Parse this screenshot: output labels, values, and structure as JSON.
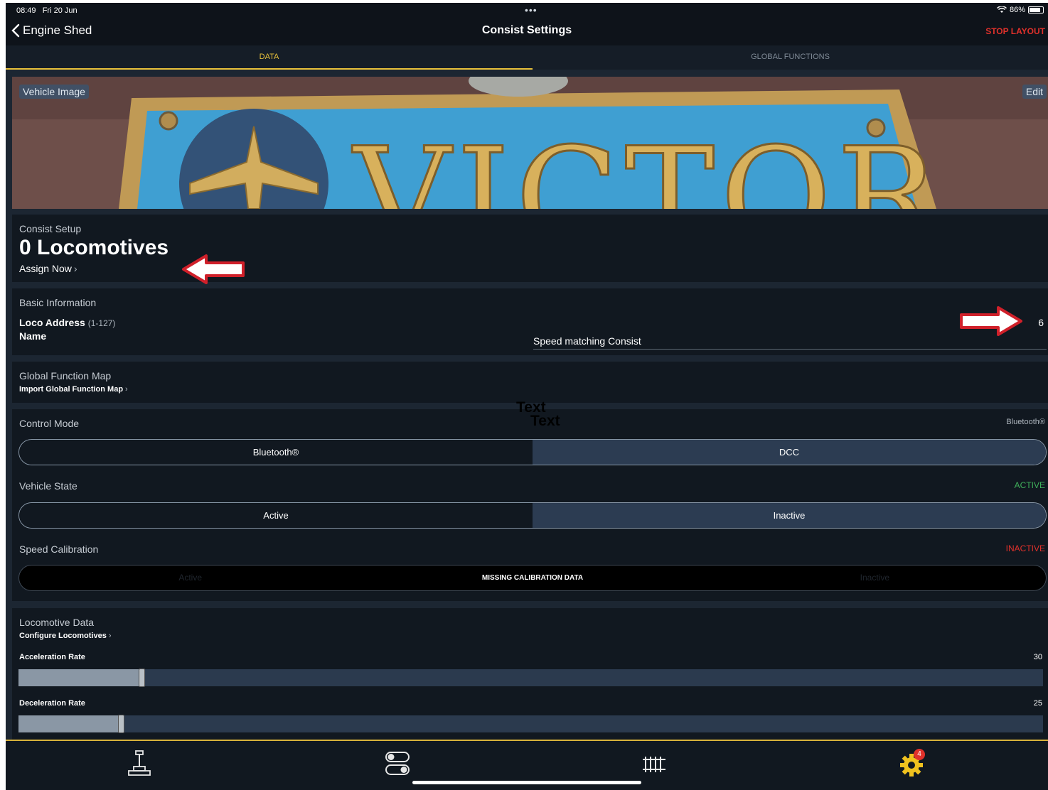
{
  "status": {
    "time": "08:49",
    "date": "Fri 20 Jun",
    "battery": "86%",
    "battery_fraction": 0.86,
    "dots": "•••"
  },
  "nav": {
    "back_label": "Engine Shed",
    "title": "Consist Settings",
    "stop_label": "STOP LAYOUT"
  },
  "tabs": {
    "data": "DATA",
    "global": "GLOBAL FUNCTIONS"
  },
  "hero": {
    "label": "Vehicle Image",
    "edit": "Edit",
    "plate_text": "VICTOR"
  },
  "consist": {
    "title": "Consist Setup",
    "count": "0 Locomotives",
    "assign": "Assign Now"
  },
  "basic": {
    "title": "Basic Information",
    "address_label": "Loco Address",
    "address_range": "(1-127)",
    "address_value": "6",
    "name_label": "Name",
    "name_value": "Speed matching Consist"
  },
  "global_map": {
    "title": "Global Function Map",
    "import": "Import Global Function Map"
  },
  "overlay": {
    "text1": "Text",
    "text2": "Text"
  },
  "control_mode": {
    "title": "Control Mode",
    "current": "Bluetooth®",
    "options": [
      "Bluetooth®",
      "DCC"
    ]
  },
  "vehicle_state": {
    "title": "Vehicle State",
    "current": "ACTIVE",
    "options": [
      "Active",
      "Inactive"
    ]
  },
  "speed_cal": {
    "title": "Speed Calibration",
    "current": "INACTIVE",
    "options": [
      "Active",
      "MISSING CALIBRATION DATA",
      "Inactive"
    ]
  },
  "loco_data": {
    "title": "Locomotive Data",
    "configure": "Configure Locomotives",
    "accel_label": "Acceleration Rate",
    "accel_value": "30",
    "accel_fraction": 0.12,
    "decel_label": "Deceleration Rate",
    "decel_value": "25",
    "decel_fraction": 0.1
  },
  "tabbar": {
    "badge": "4"
  },
  "colors": {
    "accent": "#e8c13a",
    "stop": "#e0312b",
    "active": "#3fae5a",
    "inactive": "#e0312b"
  }
}
